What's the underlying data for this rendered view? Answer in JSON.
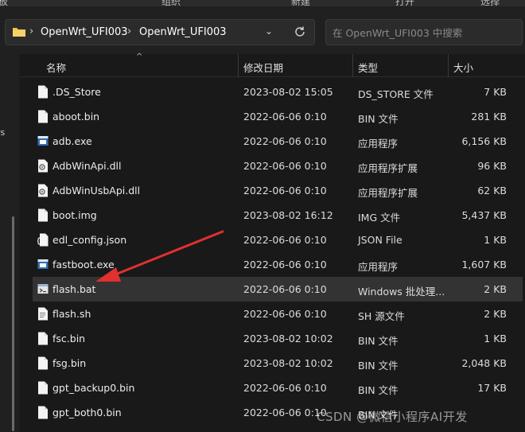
{
  "ribbon": {
    "items": [
      "板",
      "组织",
      "新建",
      "打开",
      "选择"
    ]
  },
  "address": {
    "crumbs": [
      "OpenWrt_UFI003",
      "OpenWrt_UFI003"
    ],
    "separator": "›",
    "dropdown": "⌄"
  },
  "search": {
    "placeholder": "在 OpenWrt_UFI003 中搜索"
  },
  "nav": {
    "fragment": "rs"
  },
  "columns": {
    "name": "名称",
    "date": "修改日期",
    "type": "类型",
    "size": "大小",
    "sort_glyph": "^"
  },
  "files": [
    {
      "name": ".DS_Store",
      "date": "2023-08-02 15:05",
      "type": "DS_STORE 文件",
      "size": "7 KB",
      "icon": "document-icon"
    },
    {
      "name": "aboot.bin",
      "date": "2022-06-06 0:10",
      "type": "BIN 文件",
      "size": "281 KB",
      "icon": "document-icon"
    },
    {
      "name": "adb.exe",
      "date": "2022-06-06 0:10",
      "type": "应用程序",
      "size": "6,156 KB",
      "icon": "exe-icon"
    },
    {
      "name": "AdbWinApi.dll",
      "date": "2022-06-06 0:10",
      "type": "应用程序扩展",
      "size": "96 KB",
      "icon": "dll-icon"
    },
    {
      "name": "AdbWinUsbApi.dll",
      "date": "2022-06-06 0:10",
      "type": "应用程序扩展",
      "size": "62 KB",
      "icon": "dll-icon"
    },
    {
      "name": "boot.img",
      "date": "2023-08-02 16:12",
      "type": "IMG 文件",
      "size": "5,437 KB",
      "icon": "document-icon"
    },
    {
      "name": "edl_config.json",
      "date": "2022-06-06 0:10",
      "type": "JSON File",
      "size": "1 KB",
      "icon": "json-icon"
    },
    {
      "name": "fastboot.exe",
      "date": "2022-06-06 0:10",
      "type": "应用程序",
      "size": "1,607 KB",
      "icon": "exe-icon"
    },
    {
      "name": "flash.bat",
      "date": "2022-06-06 0:10",
      "type": "Windows 批处理...",
      "size": "2 KB",
      "icon": "batch-icon",
      "selected": true
    },
    {
      "name": "flash.sh",
      "date": "2022-06-06 0:10",
      "type": "SH 源文件",
      "size": "2 KB",
      "icon": "script-icon"
    },
    {
      "name": "fsc.bin",
      "date": "2023-08-02 10:02",
      "type": "BIN 文件",
      "size": "1 KB",
      "icon": "document-icon"
    },
    {
      "name": "fsg.bin",
      "date": "2023-08-02 10:02",
      "type": "BIN 文件",
      "size": "2,048 KB",
      "icon": "document-icon"
    },
    {
      "name": "gpt_backup0.bin",
      "date": "2022-06-06 0:10",
      "type": "BIN 文件",
      "size": "17 KB",
      "icon": "document-icon"
    },
    {
      "name": "gpt_both0.bin",
      "date": "2022-06-06 0:10",
      "type": "BIN 文件",
      "size": "",
      "icon": "document-icon"
    }
  ],
  "watermark": "CSDN @微信小程序AI开发",
  "colors": {
    "selected_row": "#333333",
    "annotation_arrow": "#e03030",
    "background": "#191919"
  }
}
